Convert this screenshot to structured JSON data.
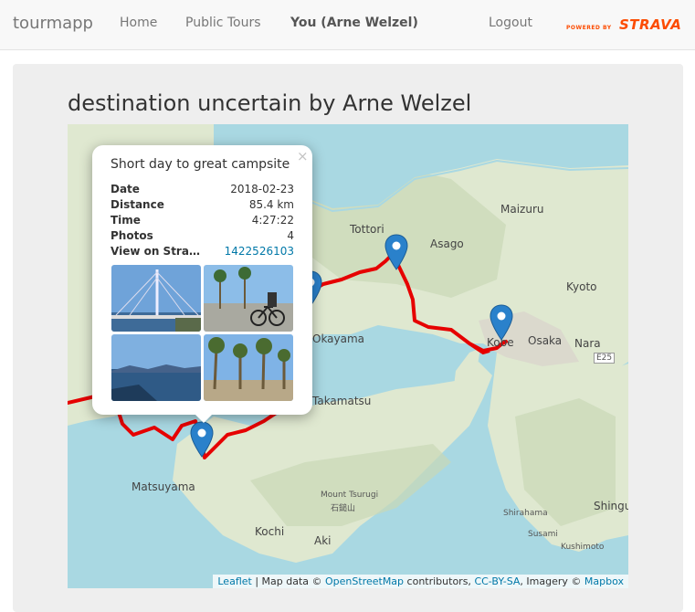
{
  "navbar": {
    "brand": "tourmapp",
    "links": [
      "Home",
      "Public Tours",
      "You (Arne Welzel)",
      "Logout"
    ],
    "active_index": 2,
    "powered_by": "POWERED BY",
    "strava": "STRAVA",
    "strava_color": "#fc4c02"
  },
  "page": {
    "title": "destination uncertain by Arne Welzel"
  },
  "map": {
    "labels": [
      "Tottori",
      "Maizuru",
      "Asago",
      "Kyoto",
      "Osaka",
      "Kobe",
      "Nara",
      "E25",
      "Takamatsu",
      "Okayama",
      "Matsuyama",
      "Mount Tsurugi",
      "石鎚山",
      "Kochi",
      "Aki",
      "Shirahama",
      "Susami",
      "Kushimoto",
      "Shingu"
    ],
    "route_color": "#e60000",
    "marker_color": "#2a81cb"
  },
  "popup": {
    "close": "×",
    "title": "Short day to great campsite",
    "rows": [
      {
        "label": "Date",
        "value": "2018-02-23"
      },
      {
        "label": "Distance",
        "value": "85.4 km"
      },
      {
        "label": "Time",
        "value": "4:27:22"
      },
      {
        "label": "Photos",
        "value": "4"
      },
      {
        "label": "View on Strava",
        "value": "1422526103"
      }
    ]
  },
  "attribution": {
    "leaflet": "Leaflet",
    "sep": " | Map data © ",
    "osm": "OpenStreetMap",
    "contrib": " contributors, ",
    "license": "CC-BY-SA",
    "imagery": ", Imagery © ",
    "mapbox": "Mapbox"
  }
}
